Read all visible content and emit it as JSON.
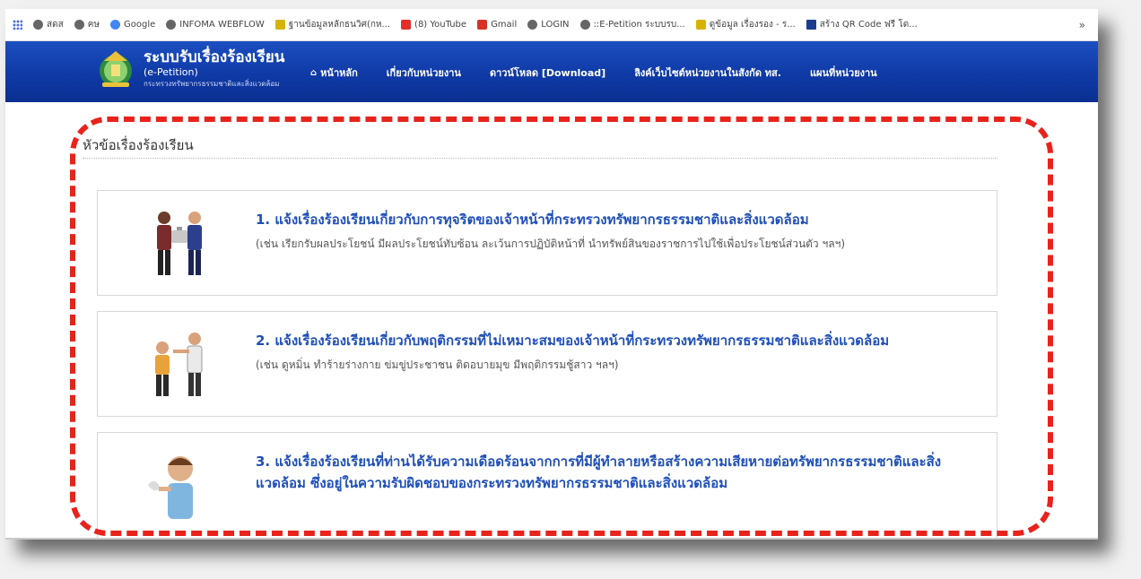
{
  "browser": {
    "bookmarks": [
      {
        "icon": "apps-icon",
        "label": "สดส"
      },
      {
        "icon": "globe-icon",
        "label": "ฅษ"
      },
      {
        "icon": "google-icon",
        "label": "Google"
      },
      {
        "icon": "globe-icon",
        "label": "INFOMA WEBFLOW"
      },
      {
        "icon": "folder-icon",
        "label": "ฐานข้อมูลหลักธนวิศ(กห..."
      },
      {
        "icon": "youtube-icon",
        "label": "(8) YouTube"
      },
      {
        "icon": "gmail-icon",
        "label": "Gmail"
      },
      {
        "icon": "globe-icon",
        "label": "LOGIN"
      },
      {
        "icon": "globe-icon",
        "label": "::E-Petition ระบบรบ..."
      },
      {
        "icon": "folder-icon",
        "label": "ดูข้อมูล เรื่องรอง - ร..."
      },
      {
        "icon": "qr-icon",
        "label": "สร้าง QR Code ฟรี โด..."
      }
    ],
    "more_label": "»"
  },
  "header": {
    "site_title": "ระบบรับเรื่องร้องเรียน",
    "site_subtitle": "(e-Petition)",
    "site_org": "กระทรวงทรัพยากรธรรมชาติและสิ่งแวดล้อม",
    "nav": [
      {
        "label": "หน้าหลัก",
        "icon": "home-icon"
      },
      {
        "label": "เกี่ยวกับหน่วยงาน"
      },
      {
        "label": "ดาวน์โหลด [Download]"
      },
      {
        "label": "ลิงค์เว็บไซต์หน่วยงานในสังกัด ทส."
      },
      {
        "label": "แผนที่หน่วยงาน"
      }
    ]
  },
  "main": {
    "section_title": "หัวข้อเรื่องร้องเรียน",
    "cards": [
      {
        "title": "1. แจ้งเรื่องร้องเรียนเกี่ยวกับการทุจริตของเจ้าหน้าที่กระทรวงทรัพยากรธรรมชาติและสิ่งแวดล้อม",
        "desc": "(เช่น เรียกรับผลประโยชน์ มีผลประโยชน์ทับซ้อน ละเว้นการปฏิบัติหน้าที่ นำทรัพย์สินของราชการไปใช้เพื่อประโยชน์ส่วนตัว ฯลฯ)",
        "image": "bribery-illustration"
      },
      {
        "title": "2. แจ้งเรื่องร้องเรียนเกี่ยวกับพฤติกรรมที่ไม่เหมาะสมของเจ้าหน้าที่กระทรวงทรัพยากรธรรมชาติและสิ่งแวดล้อม",
        "desc": "(เช่น ดูหมิ่น ทำร้ายร่างกาย ข่มขู่ประชาชน ติดอบายมุข มีพฤติกรรมชู้สาว ฯลฯ)",
        "image": "misconduct-illustration"
      },
      {
        "title": "3. แจ้งเรื่องร้องเรียนที่ท่านได้รับความเดือดร้อนจากการที่มีผู้ทำลายหรือสร้างความเสียหายต่อทรัพยากรธรรมชาติและสิ่งแวดล้อม ซึ่งอยู่ในความรับผิดชอบของกระทรวงทรัพยากรธรรมชาติและสิ่งแวดล้อม",
        "desc": "",
        "image": "distress-illustration"
      }
    ]
  },
  "colors": {
    "header_blue": "#0f3aa6",
    "card_title": "#1f4fb8",
    "annotation_red": "#e8231c"
  }
}
